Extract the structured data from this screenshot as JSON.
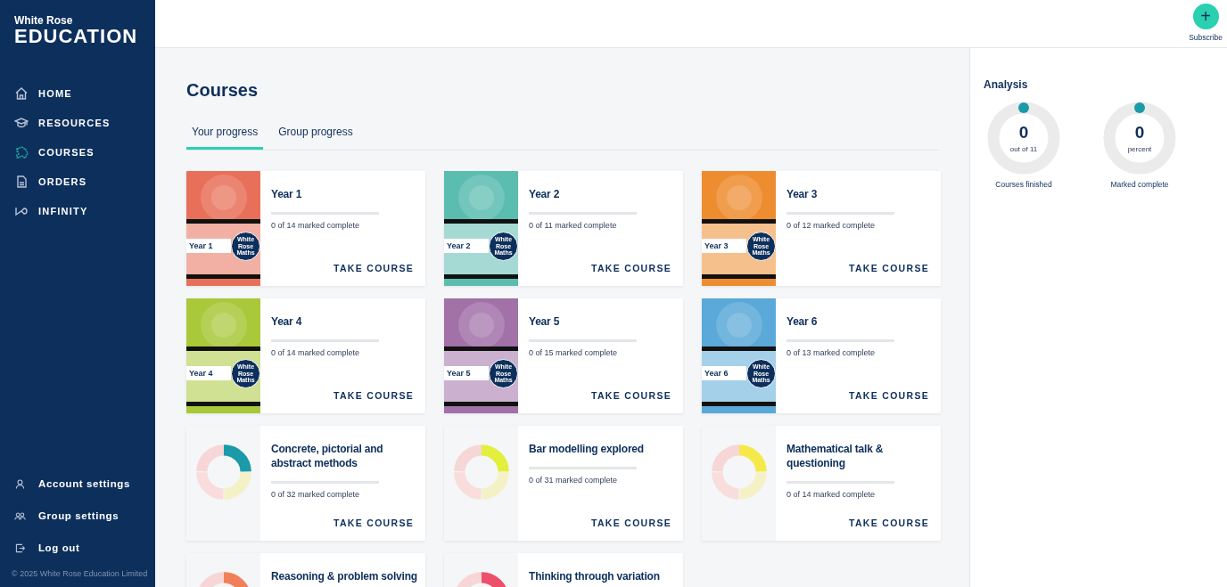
{
  "sidebar": {
    "logo": {
      "top": "White Rose",
      "bottom": "EDUCATION"
    },
    "items": [
      {
        "label": "HOME",
        "selected": false
      },
      {
        "label": "RESOURCES",
        "selected": false
      },
      {
        "label": "COURSES",
        "selected": true
      },
      {
        "label": "ORDERS",
        "selected": false
      },
      {
        "label": "INFINITY",
        "selected": false
      }
    ],
    "bottom_items": [
      {
        "label": "Account settings"
      },
      {
        "label": "Group settings"
      },
      {
        "label": "Log out"
      }
    ],
    "copyright": "© 2025 White Rose Education Limited"
  },
  "topbar": {
    "subscribe": {
      "icon": "+",
      "label": "Subscribe"
    }
  },
  "page": {
    "title": "Courses",
    "tabs": [
      {
        "label": "Your progress",
        "selected": true
      },
      {
        "label": "Group progress",
        "selected": false
      }
    ],
    "courses": [
      {
        "kind": "year",
        "title": "Year 1",
        "cover_label": "Year 1",
        "badge": "White Rose Maths",
        "color": "#e8705a",
        "progress": "0 of 14 marked complete",
        "level": 0,
        "action": "TAKE COURSE"
      },
      {
        "kind": "year",
        "title": "Year 2",
        "cover_label": "Year 2",
        "badge": "White Rose Maths",
        "color": "#5bbcb0",
        "progress": "0 of 11 marked complete",
        "level": 0,
        "action": "TAKE COURSE"
      },
      {
        "kind": "year",
        "title": "Year 3",
        "cover_label": "Year 3",
        "badge": "White Rose Maths",
        "color": "#ee8c30",
        "progress": "0 of 12 marked complete",
        "level": 0,
        "action": "TAKE COURSE"
      },
      {
        "kind": "year",
        "title": "Year 4",
        "cover_label": "Year 4",
        "badge": "White Rose Maths",
        "color": "#a9c83a",
        "progress": "0 of 14 marked complete",
        "level": 0,
        "action": "TAKE COURSE"
      },
      {
        "kind": "year",
        "title": "Year 5",
        "cover_label": "Year 5",
        "badge": "White Rose Maths",
        "color": "#a171a8",
        "progress": "0 of 15 marked complete",
        "level": 0,
        "action": "TAKE COURSE"
      },
      {
        "kind": "year",
        "title": "Year 6",
        "cover_label": "Year 6",
        "badge": "White Rose Maths",
        "color": "#5aa9d8",
        "progress": "0 of 13 marked complete",
        "level": 0,
        "action": "TAKE COURSE"
      },
      {
        "kind": "wheel",
        "title": "Concrete, pictorial and abstract methods",
        "color": "#1b9aa8",
        "progress": "0 of 32 marked complete",
        "level": 0,
        "action": "TAKE COURSE"
      },
      {
        "kind": "wheel",
        "title": "Bar modelling explored",
        "color": "#e2ef3c",
        "progress": "0 of 31 marked complete",
        "level": 0,
        "action": "TAKE COURSE"
      },
      {
        "kind": "wheel",
        "title": "Mathematical talk & questioning",
        "color": "#f5e94a",
        "progress": "0 of 14 marked complete",
        "level": 0,
        "action": "TAKE COURSE"
      },
      {
        "kind": "wheel",
        "title": "Reasoning & problem solving",
        "color": "#f0805a"
      },
      {
        "kind": "wheel",
        "title": "Thinking through variation",
        "color": "#ee4f6a"
      }
    ]
  },
  "analysis": {
    "title": "Analysis",
    "gauges": [
      {
        "value": "0",
        "unit": "out of 11",
        "caption": "Courses finished"
      },
      {
        "value": "0",
        "unit": "percent",
        "caption": "Marked complete"
      }
    ]
  }
}
